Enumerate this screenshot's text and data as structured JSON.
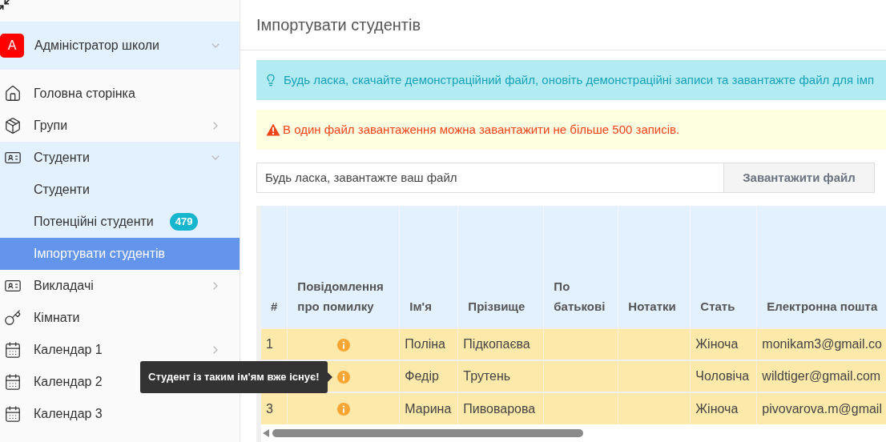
{
  "sidebar": {
    "account": {
      "avatar": "A",
      "name": "Адміністратор школи",
      "expanded": false
    },
    "items": [
      {
        "kind": "home",
        "label": "Головна сторінка",
        "has_arrow": false,
        "expanded": false,
        "selected": false
      },
      {
        "kind": "box",
        "label": "Групи",
        "has_arrow": true,
        "expanded": false,
        "selected": false
      },
      {
        "kind": "card",
        "label": "Студенти",
        "has_arrow": true,
        "expanded": true,
        "selected": false,
        "children": [
          {
            "label": "Студенти",
            "selected": false
          },
          {
            "label": "Потенційні студенти",
            "badge": "479",
            "selected": false
          },
          {
            "label": "Імпортувати студентів",
            "selected": true
          }
        ]
      },
      {
        "kind": "card",
        "label": "Викладачі",
        "has_arrow": true,
        "expanded": false,
        "selected": false
      },
      {
        "kind": "key",
        "label": "Кімнати",
        "has_arrow": false,
        "expanded": false,
        "selected": false
      },
      {
        "kind": "calendar",
        "label": "Календар 1",
        "has_arrow": true,
        "expanded": false,
        "selected": false
      },
      {
        "kind": "calendar",
        "label": "Календар 2",
        "expanded": false,
        "selected": false
      },
      {
        "kind": "calendar",
        "label": "Календар 3",
        "has_arrow": false,
        "expanded": false,
        "selected": false
      }
    ]
  },
  "page": {
    "title": "Імпортувати студентів",
    "info_alert": "Будь ласка, скачайте демонстраційний файл, оновіть демонстраційні записи та завантажте файл для імп",
    "warning_alert": "В один файл завантаження можна завантажити не більше 500 записів.",
    "upload": {
      "placeholder": "Будь ласка, завантажте ваш файл",
      "button": "Завантажити файл"
    },
    "table": {
      "columns": [
        "#",
        "Повідомлення про помилку",
        "Ім'я",
        "Прізвище",
        "По батькові",
        "Нотатки",
        "Стать",
        "Електронна пошта"
      ],
      "rows": [
        {
          "number": "1",
          "error": true,
          "first_name": "Поліна",
          "last_name": "Підкопаєва",
          "gender": "Жіноча",
          "email": "monikam3@gmail.co"
        },
        {
          "error": true,
          "first_name": "Федір",
          "last_name": "Трутень",
          "gender": "Чоловіча",
          "email": "wildtiger@gmail.com"
        },
        {
          "number": "3",
          "error": true,
          "first_name": "Марина",
          "last_name": "Пивоварова",
          "gender": "Жіноча",
          "email": "pivovarova.m@gmail"
        }
      ]
    },
    "tooltip": "Студент із таким ім'ям вже існує!"
  }
}
